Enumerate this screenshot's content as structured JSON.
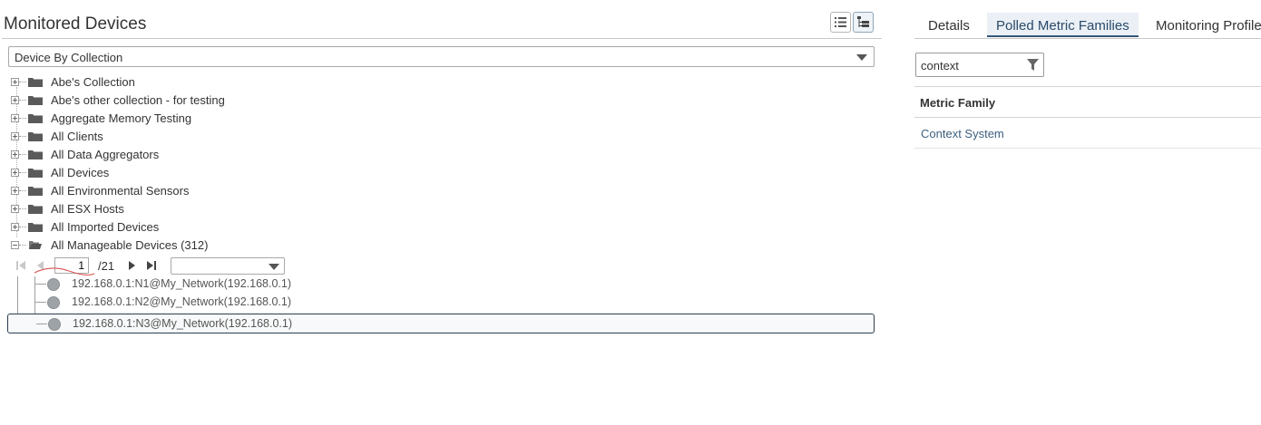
{
  "panel": {
    "title": "Monitored Devices",
    "collection_select": "Device By Collection"
  },
  "tree": {
    "items": [
      {
        "label": "Abe's Collection",
        "expanded": false
      },
      {
        "label": "Abe's other collection - for testing",
        "expanded": false
      },
      {
        "label": "Aggregate Memory Testing",
        "expanded": false
      },
      {
        "label": "All Clients",
        "expanded": false
      },
      {
        "label": "All Data Aggregators",
        "expanded": false
      },
      {
        "label": "All Devices",
        "expanded": false
      },
      {
        "label": "All Environmental Sensors",
        "expanded": false
      },
      {
        "label": "All ESX Hosts",
        "expanded": false
      },
      {
        "label": "All Imported Devices",
        "expanded": false
      },
      {
        "label": "All Manageable Devices (312)",
        "expanded": true
      }
    ],
    "pager": {
      "page": "1",
      "total": "/21"
    },
    "devices": [
      {
        "label": "192.168.0.1:N1@My_Network(192.168.0.1)",
        "selected": false
      },
      {
        "label": "192.168.0.1:N2@My_Network(192.168.0.1)",
        "selected": false
      },
      {
        "label": "192.168.0.1:N3@My_Network(192.168.0.1)",
        "selected": true
      }
    ]
  },
  "tabs": {
    "details": "Details",
    "polled": "Polled Metric Families",
    "profile": "Monitoring Profile",
    "active": "polled"
  },
  "metric_families": {
    "filter_value": "context",
    "header": "Metric Family",
    "rows": [
      "Context System"
    ]
  },
  "colors": {
    "accent": "#33577a",
    "link": "#3d5f80",
    "selected_border": "#2c3e50"
  },
  "icons": {
    "list_view": "list-view-icon",
    "tree_view": "tree-view-icon",
    "filter": "filter-icon",
    "folder": "folder-icon",
    "device": "device-status-icon"
  }
}
